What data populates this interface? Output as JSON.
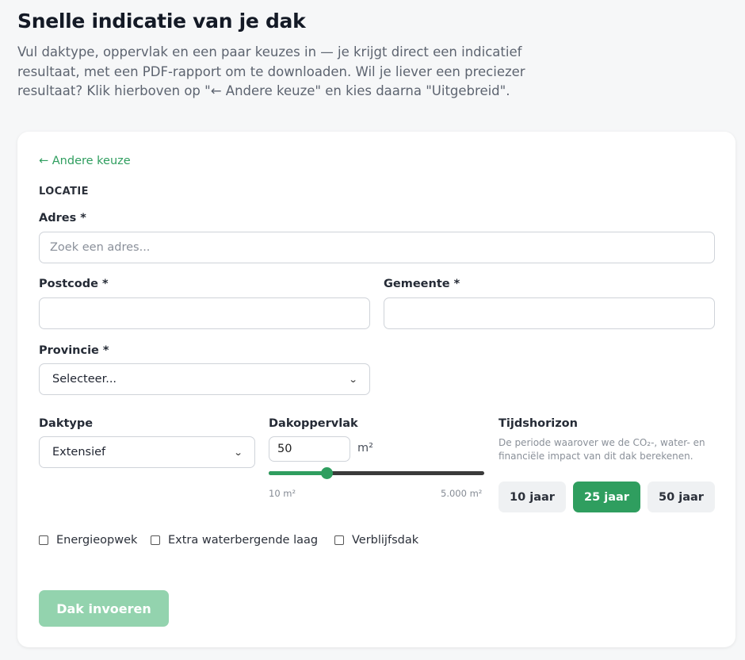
{
  "page": {
    "title": "Snelle indicatie van je dak",
    "intro": "Vul daktype, oppervlak en een paar keuzes in — je krijgt direct een indicatief resultaat, met een PDF-rapport om te downloaden. Wil je liever een preciezer resultaat? Klik hierboven op \"← Andere keuze\" en kies daarna \"Uitgebreid\"."
  },
  "form": {
    "back_link": "← Andere keuze",
    "section_location": "LOCATIE",
    "address": {
      "label": "Adres *",
      "placeholder": "Zoek een adres...",
      "value": ""
    },
    "postcode": {
      "label": "Postcode *",
      "value": ""
    },
    "municipality": {
      "label": "Gemeente *",
      "value": ""
    },
    "province": {
      "label": "Provincie *",
      "selected": "Selecteer..."
    },
    "roof_type": {
      "label": "Daktype",
      "selected": "Extensief"
    },
    "roof_area": {
      "label": "Dakoppervlak",
      "value": "50",
      "unit": "m²",
      "min_label": "10 m²",
      "max_label": "5.000 m²",
      "slider_fraction": 0.27
    },
    "time_horizon": {
      "label": "Tijdshorizon",
      "help": "De periode waarover we de CO₂-, water- en financiële impact van dit dak berekenen.",
      "options": [
        "10 jaar",
        "25 jaar",
        "50 jaar"
      ],
      "selected": "25 jaar"
    },
    "checkboxes": [
      {
        "label": "Energieopwek",
        "checked": false
      },
      {
        "label": "Extra waterbergende laag",
        "checked": false
      },
      {
        "label": "Verblijfsdak",
        "checked": false
      }
    ],
    "submit_label": "Dak invoeren"
  },
  "colors": {
    "accent": "#2f9e5f",
    "accent_disabled": "#93d3ae",
    "background": "#f6f7f8"
  }
}
